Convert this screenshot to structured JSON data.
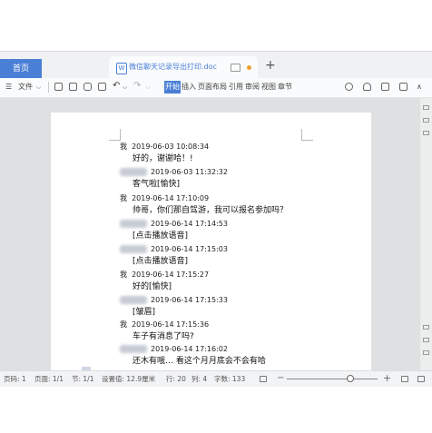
{
  "tabs": {
    "home_label": "首页",
    "doc_icon": "W",
    "doc_title": "微信聊天记录导出打印.doc",
    "new_tab_symbol": "+"
  },
  "toolbar": {
    "menu_symbol": "☰",
    "file_label": "文件",
    "dropdown_symbol": "⌵",
    "undo_symbol": "↶",
    "redo_symbol": "↷",
    "ribbon_tabs": [
      "开始",
      "插入",
      "页面布局",
      "引用",
      "审阅",
      "视图",
      "章节"
    ],
    "active_tab_index": 0,
    "more_symbol": "∧"
  },
  "document": {
    "messages": [
      {
        "sender": "我",
        "time": "2019-06-03 10:08:34",
        "text": "好的，谢谢哈！!"
      },
      {
        "sender": "",
        "time": "2019-06-03 11:32:32",
        "text": "客气啦[愉快]"
      },
      {
        "sender": "我",
        "time": "2019-06-14 17:10:09",
        "text": "帅哥，你们那自驾游，我可以报名参加吗？"
      },
      {
        "sender": "",
        "time": "2019-06-14 17:14:53",
        "text": "[点击播放语音]"
      },
      {
        "sender": "",
        "time": "2019-06-14 17:15:03",
        "text": "[点击播放语音]"
      },
      {
        "sender": "我",
        "time": "2019-06-14 17:15:27",
        "text": "好的[愉快]"
      },
      {
        "sender": "",
        "time": "2019-06-14 17:15:33",
        "text": "[皱眉]"
      },
      {
        "sender": "我",
        "time": "2019-06-14 17:15:36",
        "text": "车子有消息了吗?"
      },
      {
        "sender": "",
        "time": "2019-06-14 17:16:02",
        "text": "还木有哦… 看这个月月底会不会有哈"
      }
    ]
  },
  "status": {
    "page_no": "页码: 1",
    "page_count": "页面: 1/1",
    "section": "节: 1/1",
    "position": "设置值: 12.9厘米",
    "row": "行: 20",
    "col": "列: 4",
    "word_count": "字数: 133",
    "zoom_minus": "−",
    "zoom_plus": "+",
    "zoom_level": 0.7
  },
  "colors": {
    "accent": "#4a7fd6",
    "unsaved_dot": "#f0a030"
  }
}
